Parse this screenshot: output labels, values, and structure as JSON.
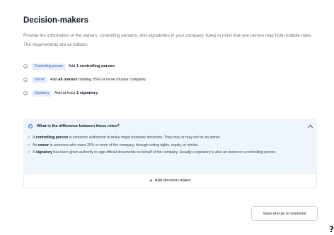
{
  "title": "Decision-makers",
  "description": "Provide the information of the owners, controlling persons, and signatories in your company. Keep in mind that one person may hold multiple roles. The requirements are as follows:",
  "requirements": [
    {
      "tag": "Controlling person",
      "pre": "Add ",
      "bold": "1 controlling person",
      "post": "."
    },
    {
      "tag": "Owner",
      "pre": "Add ",
      "bold": "all owners",
      "post": " holding 25% or more of your company."
    },
    {
      "tag": "Signatory",
      "pre": "Add at least ",
      "bold": "1 signatory",
      "post": "."
    }
  ],
  "faq": {
    "title": "What is the difference between these roles?",
    "items": [
      {
        "pre": "A ",
        "bold": "controlling person",
        "post": " is someone authorized to make major business decisions. They may or may not be an owner."
      },
      {
        "pre": "An ",
        "bold": "owner",
        "post": " is someone who owns 25% or more of the company, through voting rights, equity, or similar."
      },
      {
        "pre": "A ",
        "bold": "signatory",
        "post": " has been given authority to sign official documents on behalf of the company. Usually a signatory is also an owner or a controlling person."
      }
    ]
  },
  "add_button": "Add decision-maker",
  "save_button": "Save and go to overview",
  "icons": {
    "requirement": "check-circle-icon",
    "info": "info-icon",
    "collapse": "chevron-up-icon",
    "add": "plus-icon"
  },
  "colors": {
    "tag_background": "#e5efff",
    "tag_text": "#2f62c6",
    "faq_background": "#eef5fd"
  }
}
